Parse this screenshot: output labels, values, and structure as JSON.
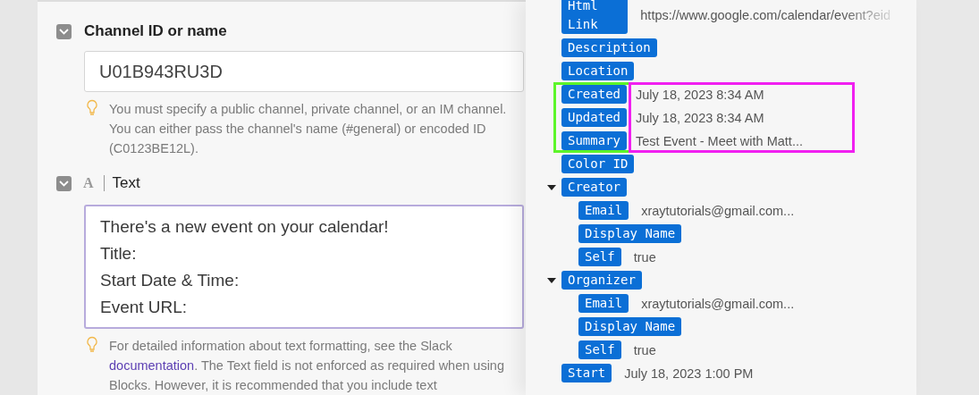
{
  "form": {
    "fields": [
      {
        "kind": "input",
        "checked": true,
        "label": "Channel ID or name",
        "value": "U01B943RU3D",
        "hint": [
          {
            "text": "You must specify a public channel, private channel, or an IM channel. You can either pass the channel's name (#general) or encoded ID (C0123BE12L)."
          }
        ]
      },
      {
        "kind": "textarea",
        "checked": true,
        "type_icon": "A",
        "label": "Text",
        "value": "There's a new event on your calendar!\nTitle:\nStart Date & Time:\nEvent URL:",
        "hint": [
          {
            "text": "For detailed information about text formatting, see the Slack "
          },
          {
            "text": "documentation",
            "kind": "link"
          },
          {
            "text": ". The Text field is not enforced as required when using Blocks. However, it is recommended that you include text"
          }
        ]
      }
    ]
  },
  "data_tree": {
    "items": [
      {
        "label": "Html Link",
        "value": "https://www.google.com/calendar/event?eid",
        "faded": true
      },
      {
        "label": "Description"
      },
      {
        "label": "Location"
      },
      {
        "label": "Created",
        "value": "July 18, 2023 8:34 AM",
        "highlighted": true
      },
      {
        "label": "Updated",
        "value": "July 18, 2023 8:34 AM",
        "highlighted": true
      },
      {
        "label": "Summary",
        "value": "Test Event - Meet with Matt...",
        "highlighted": true
      },
      {
        "label": "Color ID"
      },
      {
        "label": "Creator",
        "expanded": true,
        "children": [
          {
            "label": "Email",
            "value": "xraytutorials@gmail.com..."
          },
          {
            "label": "Display Name"
          },
          {
            "label": "Self",
            "value": "true"
          }
        ]
      },
      {
        "label": "Organizer",
        "expanded": true,
        "children": [
          {
            "label": "Email",
            "value": "xraytutorials@gmail.com..."
          },
          {
            "label": "Display Name"
          },
          {
            "label": "Self",
            "value": "true"
          }
        ]
      },
      {
        "label": "Start",
        "value": "July 18, 2023 1:00 PM"
      }
    ]
  }
}
